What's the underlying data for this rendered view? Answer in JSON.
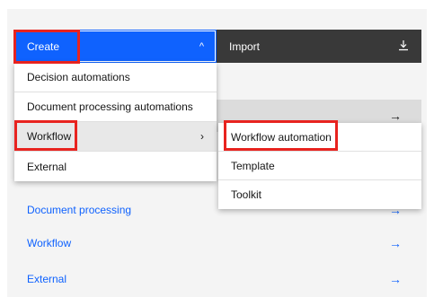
{
  "topbar": {
    "create_label": "Create",
    "import_label": "Import"
  },
  "menu": {
    "items": [
      {
        "label": "Decision automations"
      },
      {
        "label": "Document processing automations"
      },
      {
        "label": "Workflow"
      },
      {
        "label": "External"
      }
    ]
  },
  "submenu": {
    "items": [
      {
        "label": "Workflow automation"
      },
      {
        "label": "Template"
      },
      {
        "label": "Toolkit"
      }
    ]
  },
  "links": [
    {
      "label": "Document processing"
    },
    {
      "label": "Workflow"
    },
    {
      "label": "External"
    }
  ],
  "icons": {
    "chevron_up": "^",
    "chevron_right": "›",
    "arrow_right": "→",
    "download": "⤓"
  },
  "colors": {
    "primary": "#0f62fe",
    "dark_bar": "#393939",
    "highlight": "#e8231f"
  }
}
